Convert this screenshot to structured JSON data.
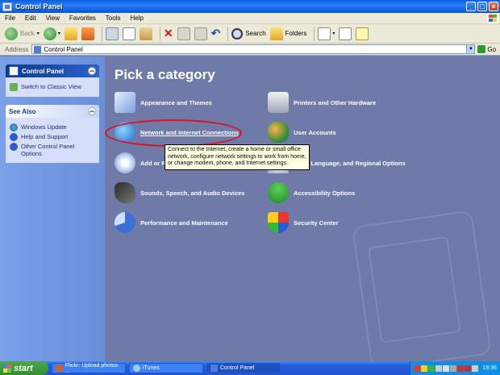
{
  "window": {
    "title": "Control Panel"
  },
  "menu": [
    "File",
    "Edit",
    "View",
    "Favorites",
    "Tools",
    "Help"
  ],
  "toolbar": {
    "back": "Back",
    "search": "Search",
    "folders": "Folders"
  },
  "address": {
    "label": "Address",
    "value": "Control Panel",
    "go": "Go"
  },
  "left_panel": {
    "control_panel_title": "Control Panel",
    "switch_classic": "Switch to Classic View",
    "see_also_title": "See Also",
    "see_also_items": [
      "Windows Update",
      "Help and Support",
      "Other Control Panel Options"
    ]
  },
  "main": {
    "title": "Pick a category",
    "categories": [
      "Appearance and Themes",
      "Printers and Other Hardware",
      "Network and Internet Connections",
      "User Accounts",
      "Add or R",
      "Time, Language, and Regional Options",
      "Sounds, Speech, and Audio Devices",
      "Accessibility Options",
      "Performance and Maintenance",
      "Security Center"
    ],
    "tooltip": "Connect to the Internet, create a home or small office network, configure network settings to work from home, or change modem, phone, and Internet settings."
  },
  "taskbar": {
    "start": "start",
    "buttons": [
      "Flickr: Upload photos ...",
      "iTunes",
      "Control Panel"
    ],
    "time": "19:36"
  }
}
